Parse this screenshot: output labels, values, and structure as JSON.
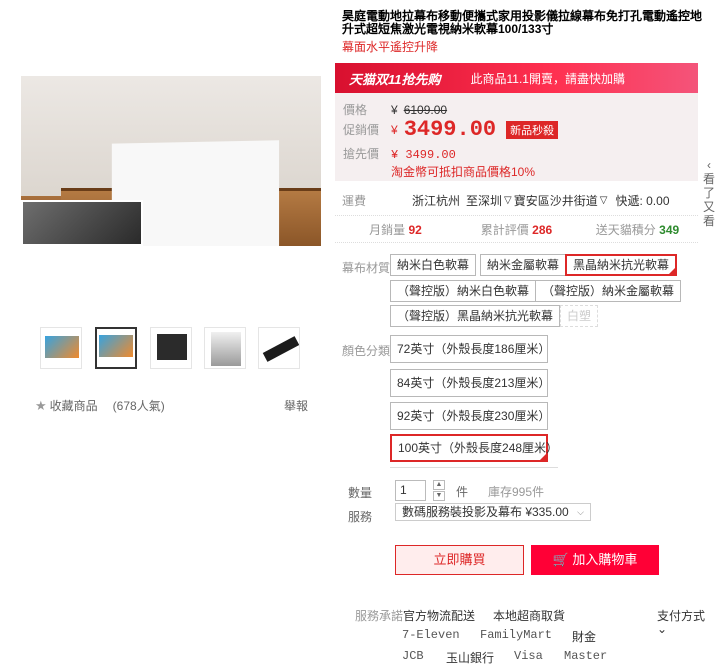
{
  "product": {
    "title": "昊庭電動地拉幕布移動便攜式家用投影儀拉線幕布免打孔電動遙控地升式超短焦激光電視納米軟幕100/133寸",
    "subtitle": "幕面水平遙控升降"
  },
  "gallery": {
    "collect_label": "收藏商品",
    "popularity": "(678人氣)",
    "report_label": "舉報"
  },
  "promo": {
    "logo_text": "天猫双11抢先购",
    "message": "此商品11.1開賣，請盡快加購"
  },
  "price": {
    "orig_label": "價格",
    "orig_currency": "¥",
    "orig_value": "6109.00",
    "promo_label": "促銷價",
    "promo_currency": "¥",
    "promo_value": "3499.00",
    "promo_tag": "新品秒殺",
    "rush_label": "搶先價",
    "rush_value": "¥ 3499.00",
    "gold_note": "淘金幣可抵扣商品價格10%"
  },
  "shipping": {
    "label": "運費",
    "from": "浙江杭州",
    "to_prefix": "至",
    "to_city": "深圳",
    "to_district": "寶安區沙井街道",
    "fee": "快遞: 0.00"
  },
  "stats": {
    "monthly_label": "月銷量",
    "monthly_value": "92",
    "reviews_label": "累計評價",
    "reviews_value": "286",
    "points_label": "送天貓積分",
    "points_value": "349"
  },
  "material": {
    "label": "幕布材質",
    "options": [
      "納米白色軟幕",
      "納米金屬軟幕",
      "黑晶納米抗光軟幕",
      "（聲控版）納米白色軟幕",
      "（聲控版）納米金屬軟幕",
      "（聲控版）黑晶納米抗光軟幕",
      "白塑"
    ]
  },
  "color": {
    "label": "顏色分類",
    "options": [
      "72英寸（外殼長度186厘米）",
      "84英寸（外殼長度213厘米）",
      "92英寸（外殼長度230厘米）",
      "100英寸（外殼長度248厘米）"
    ]
  },
  "quantity": {
    "label": "數量",
    "value": "1",
    "unit": "件",
    "stock": "庫存995件"
  },
  "service": {
    "label": "服務",
    "selected": "數碼服務裝投影及幕布 ¥335.00"
  },
  "actions": {
    "buy_now": "立即購買",
    "add_cart": "加入購物車"
  },
  "promise": {
    "label": "服務承諾",
    "items": [
      "官方物流配送",
      "本地超商取貨"
    ],
    "pay_label": "支付方式",
    "pay_row1": [
      "7-Eleven",
      "FamilyMart",
      "財金"
    ],
    "pay_row2": [
      "JCB",
      "玉山銀行",
      "Visa",
      "Master"
    ]
  },
  "side": {
    "label": "看了又看"
  }
}
